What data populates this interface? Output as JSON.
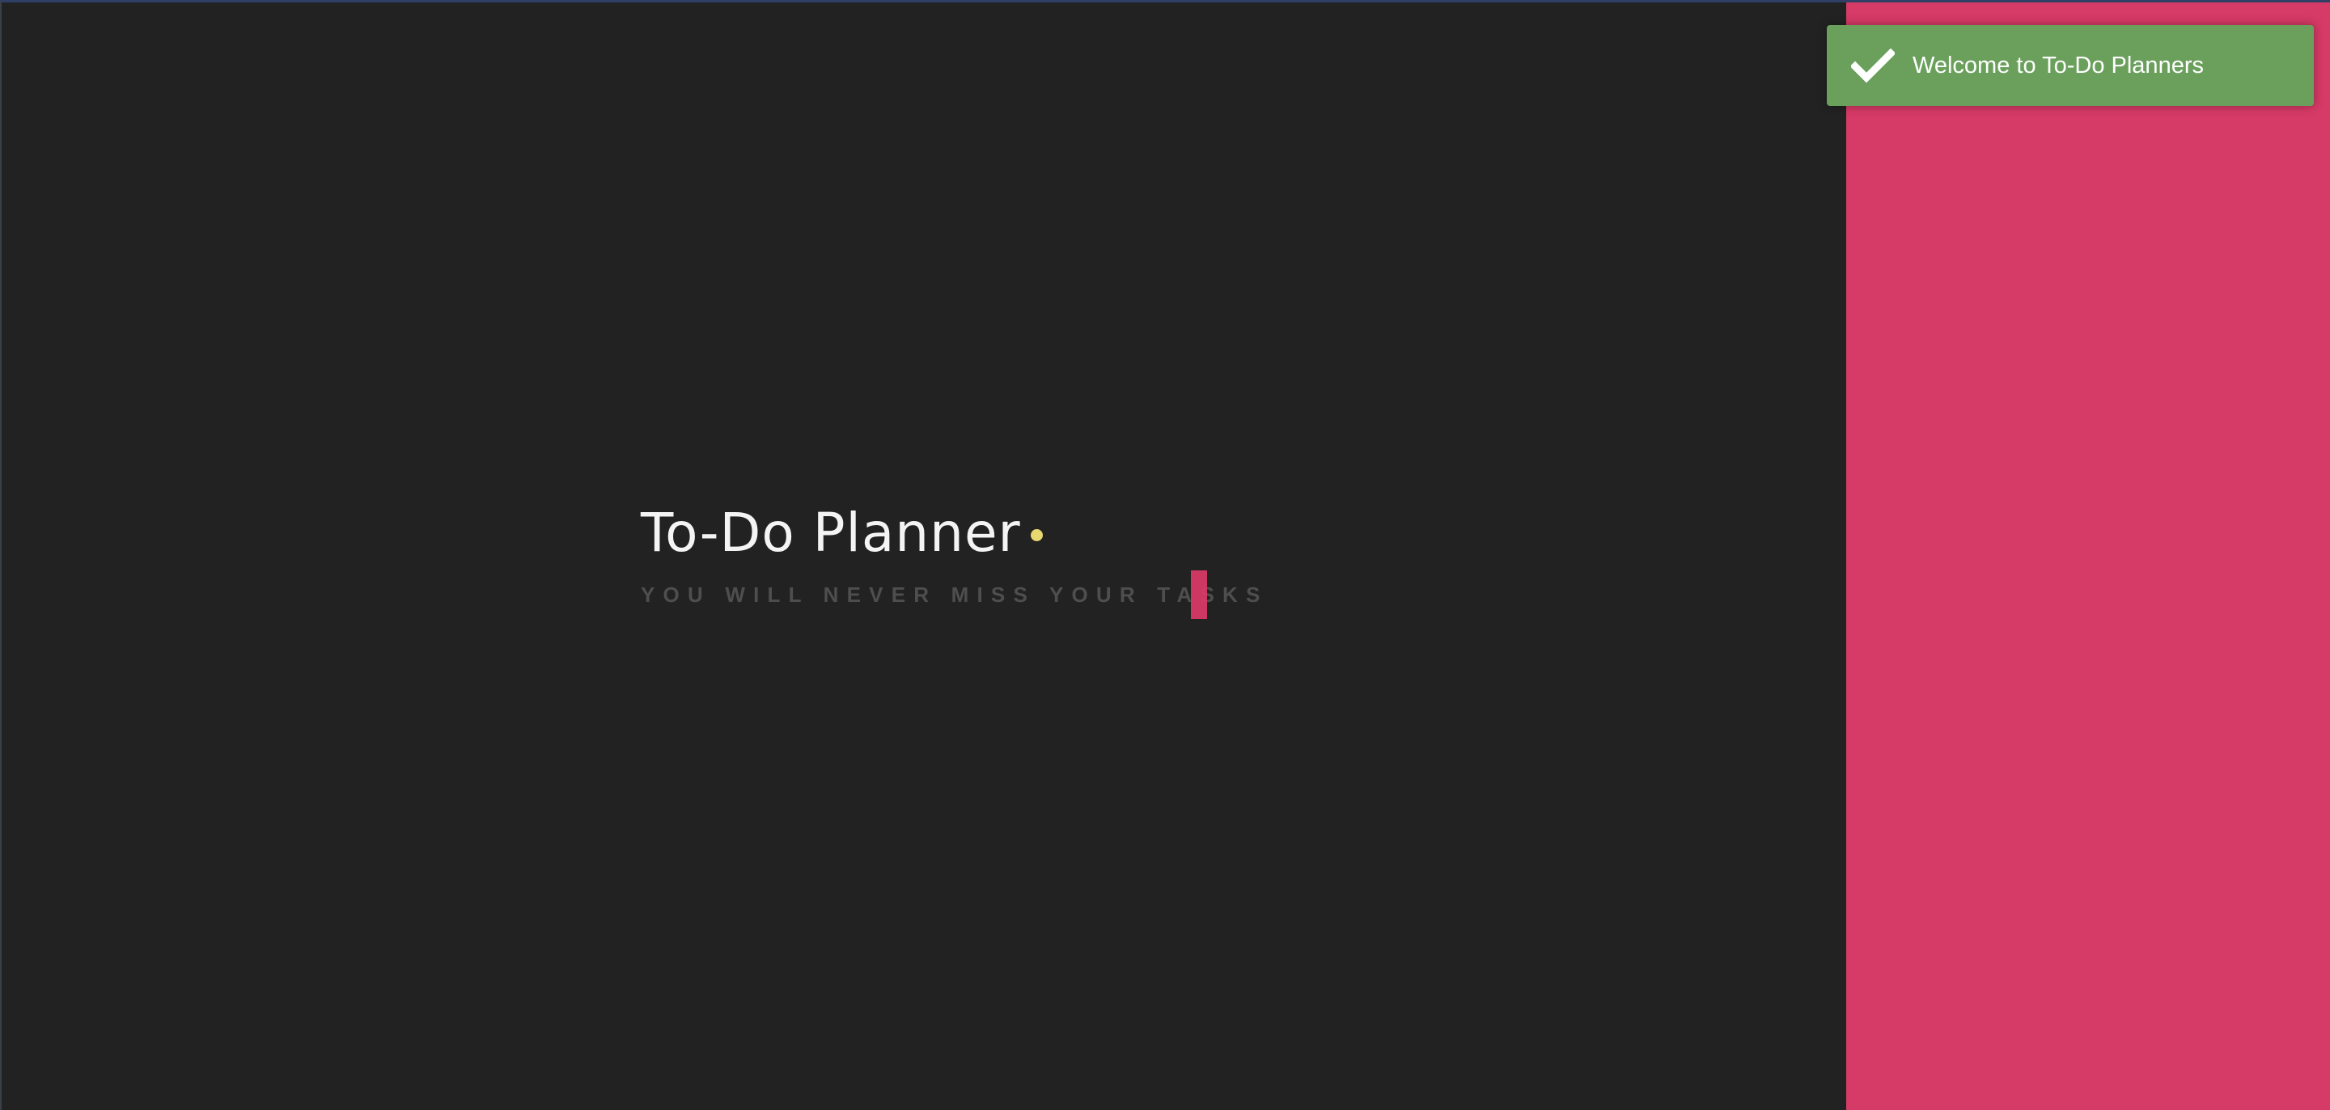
{
  "hero": {
    "title": "To-Do Planner",
    "subtitle": "YOU WILL NEVER MISS YOUR TASKS"
  },
  "toast": {
    "message": "Welcome to To-Do Planners",
    "icon": "check-icon"
  },
  "colors": {
    "background": "#222222",
    "accent": "#d63a66",
    "title_dot": "#e8d870",
    "toast_background": "#6aa05c",
    "title_text": "#f4f4f4",
    "subtitle_text": "#4e4e4e"
  }
}
